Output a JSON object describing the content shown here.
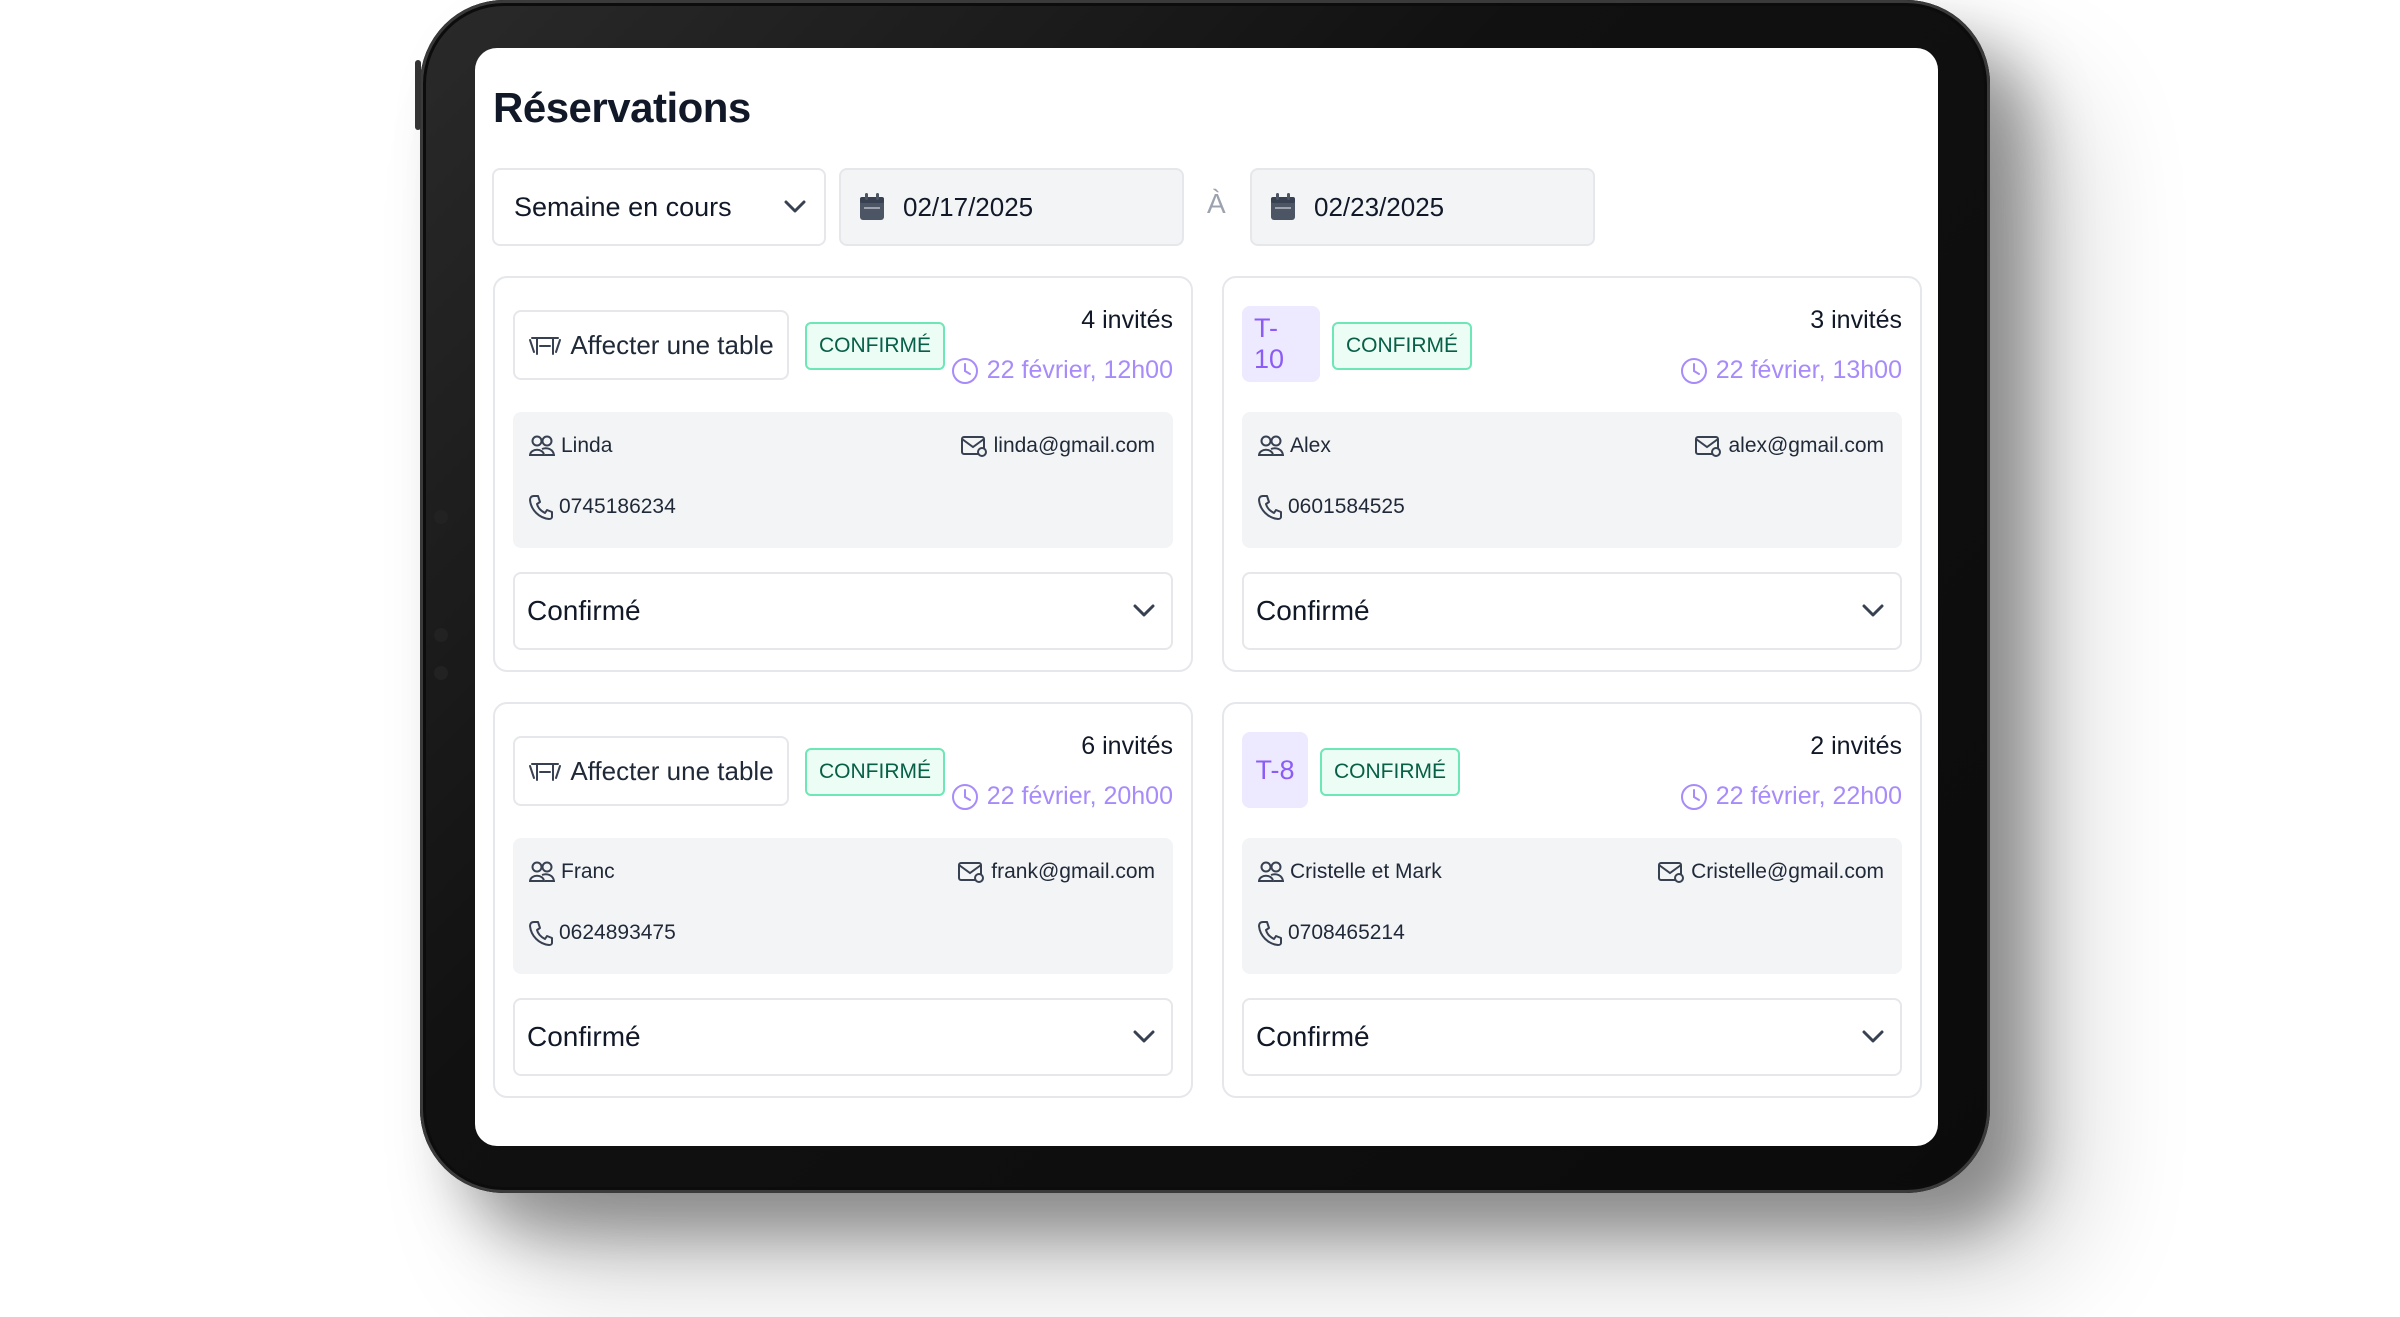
{
  "page": {
    "title": "Réservations"
  },
  "filters": {
    "period": "Semaine en cours",
    "start_date": "02/17/2025",
    "separator": "À",
    "end_date": "02/23/2025"
  },
  "assign_label": "Affecter une table",
  "reservations": [
    {
      "table": "",
      "status_badge": "CONFIRMÉ",
      "guests": "4 invités",
      "datetime": "22 février, 12h00",
      "name": "Linda",
      "email": "linda@gmail.com",
      "phone": "0745186234",
      "status": "Confirmé"
    },
    {
      "table": "T-10",
      "status_badge": "CONFIRMÉ",
      "guests": "3 invités",
      "datetime": "22 février, 13h00",
      "name": "Alex",
      "email": "alex@gmail.com",
      "phone": "0601584525",
      "status": "Confirmé"
    },
    {
      "table": "",
      "status_badge": "CONFIRMÉ",
      "guests": "6 invités",
      "datetime": "22 février, 20h00",
      "name": "Franc",
      "email": "frank@gmail.com",
      "phone": "0624893475",
      "status": "Confirmé"
    },
    {
      "table": "T-8",
      "status_badge": "CONFIRMÉ",
      "guests": "2 invités",
      "datetime": "22 février, 22h00",
      "name": "Cristelle et Mark",
      "email": "Cristelle@gmail.com",
      "phone": "0708465214",
      "status": "Confirmé"
    }
  ],
  "colors": {
    "accent": "#a78bfa",
    "table_tag_bg": "#ede9fe",
    "badge_bg": "#ecfdf5",
    "badge_border": "#6ee7b7",
    "badge_text": "#065f46",
    "info_bg": "#f3f4f6"
  },
  "icons": {
    "filter_chevron": "chevron-down-icon",
    "date": "calendar-icon",
    "assign": "table-icon",
    "time": "clock-icon",
    "name": "users-icon",
    "email": "mail-icon",
    "phone": "phone-icon",
    "select_chevron": "chevron-down-icon"
  }
}
